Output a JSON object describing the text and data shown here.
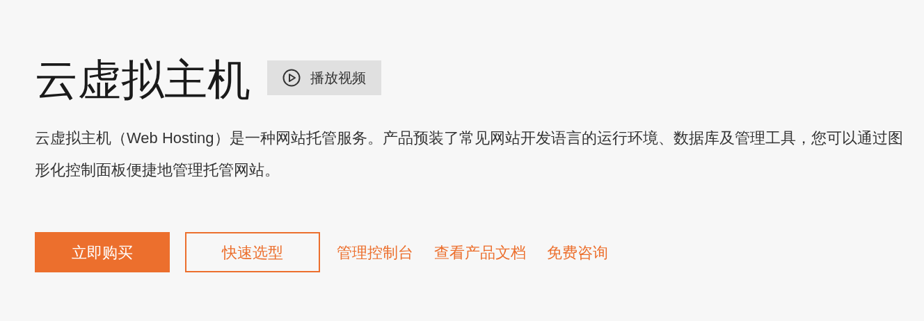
{
  "title": "云虚拟主机",
  "video_button": "播放视频",
  "description": "云虚拟主机（Web Hosting）是一种网站托管服务。产品预装了常见网站开发语言的运行环境、数据库及管理工具，您可以通过图形化控制面板便捷地管理托管网站。",
  "actions": [
    {
      "label": "立即购买",
      "kind": "primary"
    },
    {
      "label": "快速选型",
      "kind": "outline"
    },
    {
      "label": "管理控制台",
      "kind": "link"
    },
    {
      "label": "查看产品文档",
      "kind": "link"
    },
    {
      "label": "免费咨询",
      "kind": "link"
    }
  ]
}
